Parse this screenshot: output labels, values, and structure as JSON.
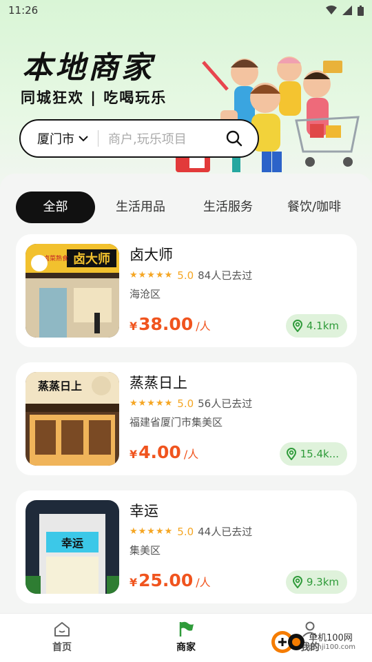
{
  "status_bar": {
    "time": "11:26"
  },
  "header": {
    "title": "本地商家",
    "subtitle": "同城狂欢 | 吃喝玩乐"
  },
  "search": {
    "city": "厦门市",
    "placeholder": "商户,玩乐项目"
  },
  "tabs": [
    {
      "label": "全部",
      "active": true
    },
    {
      "label": "生活用品",
      "active": false
    },
    {
      "label": "生活服务",
      "active": false
    },
    {
      "label": "餐饮/咖啡",
      "active": false
    }
  ],
  "merchants": [
    {
      "name": "卤大师",
      "stars": "★★★★★",
      "score": "5.0",
      "visits": "84人已去过",
      "area": "海沧区",
      "currency": "¥",
      "price": "38.00",
      "unit": "/人",
      "distance": "4.1km",
      "sign_text": "卤大师",
      "sign_small": "卤菜熟食"
    },
    {
      "name": "蒸蒸日上",
      "stars": "★★★★★",
      "score": "5.0",
      "visits": "56人已去过",
      "area": "福建省厦门市集美区",
      "currency": "¥",
      "price": "4.00",
      "unit": "/人",
      "distance": "15.4k...",
      "sign_text": "蒸蒸日上"
    },
    {
      "name": "幸运",
      "stars": "★★★★★",
      "score": "5.0",
      "visits": "44人已去过",
      "area": "集美区",
      "currency": "¥",
      "price": "25.00",
      "unit": "/人",
      "distance": "9.3km",
      "sign_text": "幸运"
    }
  ],
  "bottom_nav": [
    {
      "label": "首页",
      "icon": "home-icon",
      "active": false
    },
    {
      "label": "商家",
      "icon": "flag-icon",
      "active": true
    },
    {
      "label": "我的",
      "icon": "user-icon",
      "active": false
    }
  ],
  "watermark": {
    "text": "单机100网",
    "url": "danji100.com"
  },
  "colors": {
    "accent_price": "#f0541e",
    "star": "#f5a623",
    "distance_green": "#2f9b3a",
    "active_tab_bg": "#111111"
  }
}
